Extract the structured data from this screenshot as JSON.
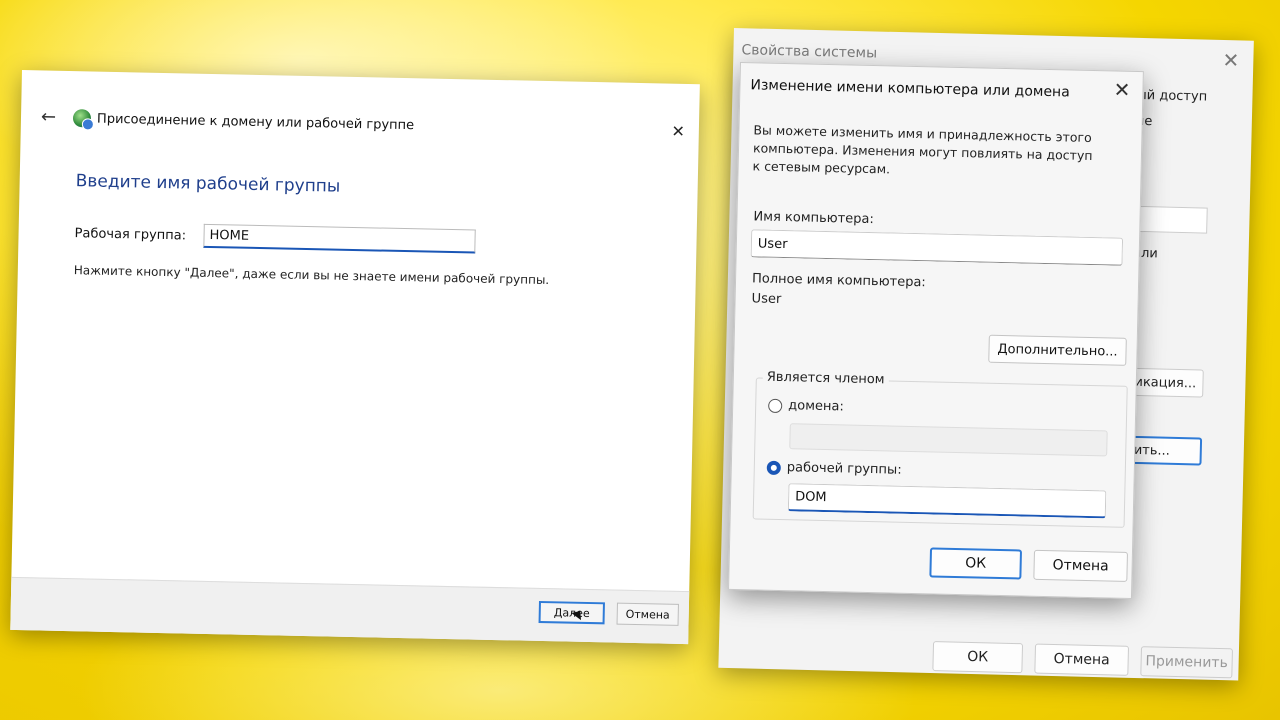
{
  "wizard": {
    "title": "Присоединение к домену или рабочей группе",
    "back_icon": "←",
    "close_icon": "✕",
    "heading": "Введите имя рабочей группы",
    "workgroup_label": "Рабочая группа:",
    "workgroup_value": "HOME",
    "hint": "Нажмите кнопку \"Далее\", даже если вы не знаете имени рабочей группы.",
    "next_label": "Далее",
    "cancel_label": "Отмена"
  },
  "system_properties": {
    "title": "Свойства системы",
    "close_icon": "✕",
    "tab_fragment_1": "ый доступ",
    "tab_fragment_2": "ие",
    "text_fragment": "или",
    "button_fragment_1": "икация...",
    "button_fragment_2": "ить...",
    "ok_label": "ОК",
    "cancel_label": "Отмена",
    "apply_label": "Применить"
  },
  "change_name_dialog": {
    "title": "Изменение имени компьютера или домена",
    "close_icon": "✕",
    "description": "Вы можете изменить имя и принадлежность этого компьютера. Изменения могут повлиять на доступ к сетевым ресурсам.",
    "computer_name_label": "Имя компьютера:",
    "computer_name_value": "User",
    "full_name_label": "Полное имя компьютера:",
    "full_name_value": "User",
    "more_button": "Дополнительно...",
    "member_of_legend": "Является членом",
    "domain_option": "домена:",
    "domain_value": "",
    "workgroup_option": "рабочей группы:",
    "workgroup_value": "DOM",
    "selected_option": "workgroup",
    "ok_label": "ОК",
    "cancel_label": "Отмена"
  }
}
